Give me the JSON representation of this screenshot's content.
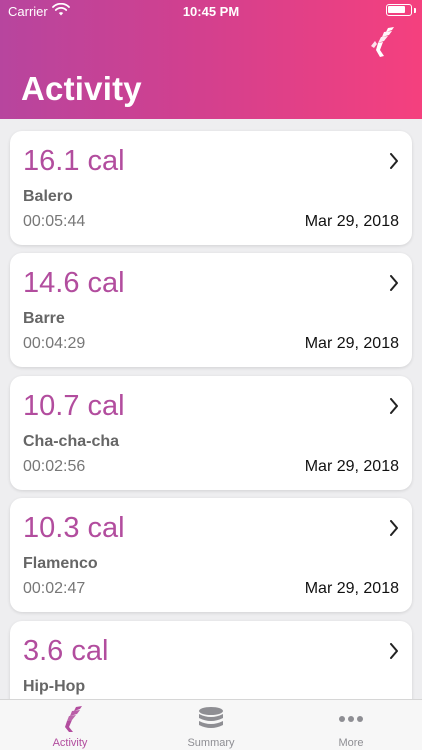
{
  "status_bar": {
    "carrier": "Carrier",
    "time": "10:45 PM"
  },
  "header": {
    "title": "Activity"
  },
  "activities": [
    {
      "calories": "16.1 cal",
      "dance": "Balero",
      "duration": "00:05:44",
      "date": "Mar 29, 2018"
    },
    {
      "calories": "14.6 cal",
      "dance": "Barre",
      "duration": "00:04:29",
      "date": "Mar 29, 2018"
    },
    {
      "calories": "10.7 cal",
      "dance": "Cha-cha-cha",
      "duration": "00:02:56",
      "date": "Mar 29, 2018"
    },
    {
      "calories": "10.3 cal",
      "dance": "Flamenco",
      "duration": "00:02:47",
      "date": "Mar 29, 2018"
    },
    {
      "calories": "3.6 cal",
      "dance": "Hip-Hop",
      "duration": "",
      "date": ""
    }
  ],
  "tabs": [
    {
      "label": "Activity",
      "icon": "dancer-icon",
      "active": true
    },
    {
      "label": "Summary",
      "icon": "database-icon",
      "active": false
    },
    {
      "label": "More",
      "icon": "more-dots-icon",
      "active": false
    }
  ],
  "colors": {
    "accent": "#b24d9e",
    "gradient_start": "#b7459e",
    "gradient_end": "#f5407e"
  }
}
